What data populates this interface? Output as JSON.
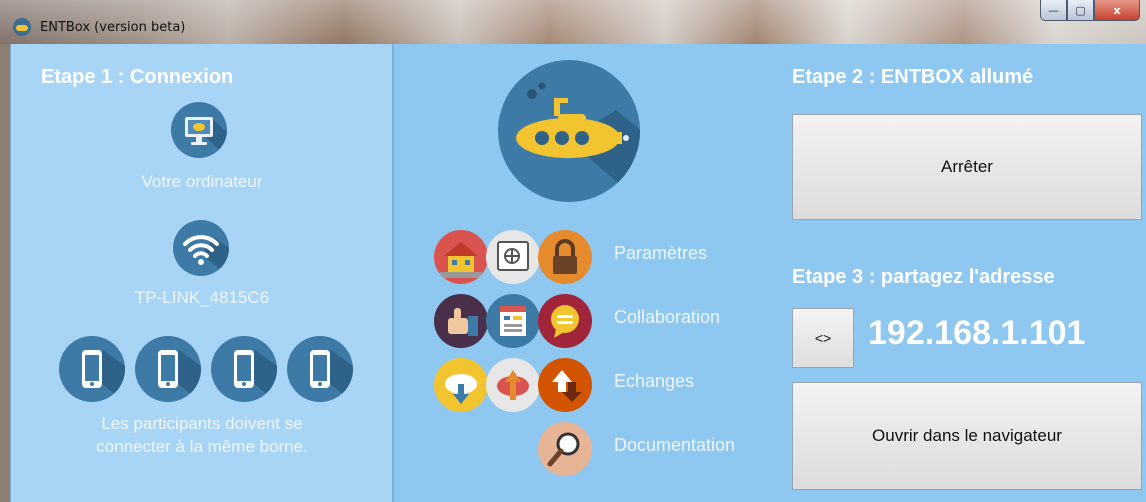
{
  "window": {
    "title": "ENTBox (version beta)",
    "controls": {
      "minimize": "—",
      "maximize": "▢",
      "close": "x"
    }
  },
  "left": {
    "step_title": "Etape 1 : Connexion",
    "computer_label": "Votre ordinateur",
    "wifi_label": "TP-LINK_4815C6",
    "participants_text_line1": "Les participants doivent se",
    "participants_text_line2": "connecter à la même borne."
  },
  "middle": {
    "features": [
      {
        "label": "Paramètres"
      },
      {
        "label": "Collaboration"
      },
      {
        "label": "Echanges"
      },
      {
        "label": "Documentation"
      }
    ]
  },
  "right": {
    "step2_title": "Etape 2 : ENTBOX allumé",
    "stop_button": "Arrêter",
    "step3_title": "Etape 3 : partagez l'adresse",
    "toggle_button": "<>",
    "ip_address": "192.168.1.101",
    "open_button": "Ouvrir dans le navigateur"
  },
  "colors": {
    "panel_light": "#a8d5f6",
    "panel": "#8ec7f0",
    "icon_blue": "#3e7aa6",
    "submarine_yellow": "#f2c530"
  }
}
